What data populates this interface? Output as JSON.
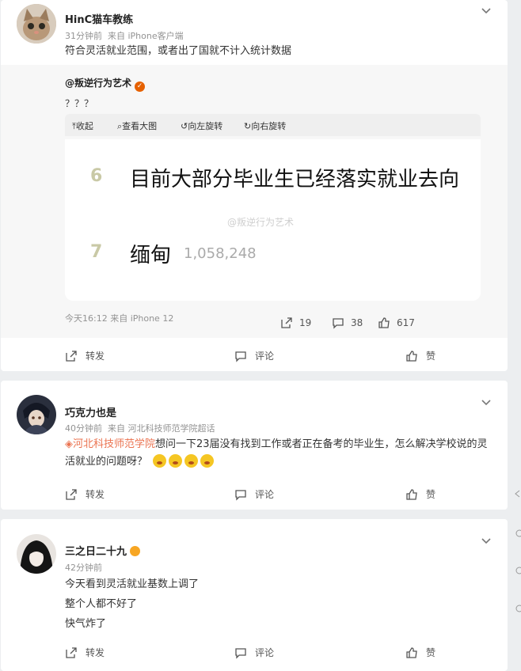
{
  "comments": [
    {
      "username": "HinC猫车教练",
      "time": "31分钟前",
      "source": "来自 iPhone客户端",
      "text": "符合灵活就业范围，或者出了国就不计入统计数据",
      "repost": {
        "author": "@叛逆行为艺术",
        "text": "？？？",
        "image_toolbar": [
          "收起",
          "查看大图",
          "向左旋转",
          "向右旋转"
        ],
        "hot_items": [
          {
            "rank": "6",
            "title": "目前大部分毕业生已经落实就业去向",
            "count": ""
          },
          {
            "rank": "7",
            "title": "缅甸",
            "count": "1,058,248"
          }
        ],
        "watermark": "@叛逆行为艺术",
        "footer_time": "今天16:12",
        "footer_source": "来自 iPhone 12",
        "reposts": "19",
        "comments": "38",
        "likes": "617"
      },
      "actions": {
        "forward": "转发",
        "comment": "评论",
        "like": "赞"
      }
    },
    {
      "username": "巧克力也是",
      "time": "40分钟前",
      "source": "来自 河北科技师范学院超话",
      "topic": "河北科技师范学院",
      "text": "想问一下23届没有找到工作或者正在备考的毕业生，怎么解决学校说的灵活就业的问题呀？",
      "emoji_count": 4,
      "actions": {
        "forward": "转发",
        "comment": "评论",
        "like": "赞"
      }
    },
    {
      "username": "三之日二十九",
      "time": "42分钟前",
      "lines": [
        "今天看到灵活就业基数上调了",
        "整个人都不好了",
        "快气炸了"
      ],
      "actions": {
        "forward": "转发",
        "comment": "评论",
        "like": "赞"
      }
    }
  ],
  "colors": {
    "background": "#eceef0",
    "card": "#ffffff",
    "meta": "#939393",
    "topic": "#eb7350",
    "vip": "#e66100"
  }
}
